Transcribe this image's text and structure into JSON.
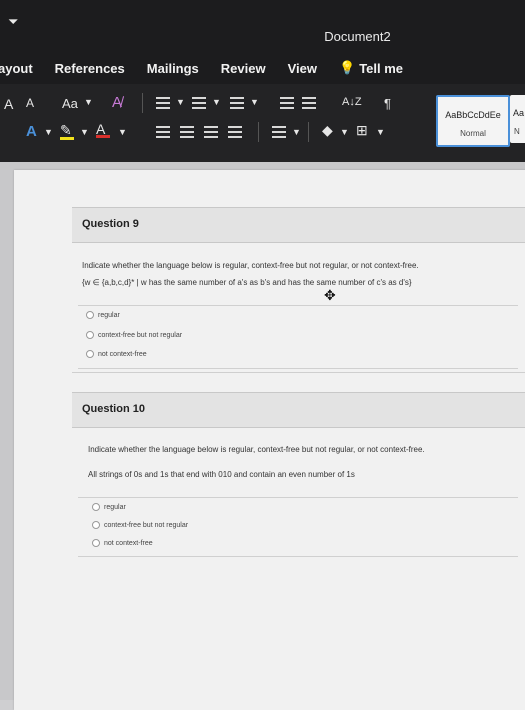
{
  "app": {
    "document_title": "Document2",
    "quick_access_icon": "dropdown-caret-icon"
  },
  "tabs": [
    {
      "label": "ayout"
    },
    {
      "label": "References"
    },
    {
      "label": "Mailings"
    },
    {
      "label": "Review"
    },
    {
      "label": "View"
    },
    {
      "label": "Tell me",
      "icon": "lightbulb-icon"
    }
  ],
  "toolbar": {
    "font_grow": "A",
    "font_shrink": "A",
    "change_case": "Aa",
    "pilcrow": "¶",
    "sort": "A↓Z",
    "styles": [
      {
        "preview": "AaBbCcDdEe",
        "name": "Normal"
      },
      {
        "preview": "Aa",
        "name": "N"
      }
    ]
  },
  "questions": [
    {
      "label": "Question 9",
      "prompt": "Indicate whether the language below is regular, context-free but not regular, or not context-free.",
      "language": "{w ∈ {a,b,c,d}* | w has the same number of a's as b's and has the same number of c's as d's}",
      "options": [
        "regular",
        "context-free but not regular",
        "not context-free"
      ]
    },
    {
      "label": "Question 10",
      "prompt": "Indicate whether the language below is regular, context-free but not regular, or not context-free.",
      "language": "All strings of 0s and 1s that end with 010 and contain an even number of 1s",
      "options": [
        "regular",
        "context-free but not regular",
        "not context-free"
      ]
    }
  ],
  "colors": {
    "ribbon_dark": "#1c1c1e",
    "style_highlight": "#4a90d9",
    "highlighter_yellow": "#f2e21c",
    "font_color_red": "#d9302c"
  }
}
